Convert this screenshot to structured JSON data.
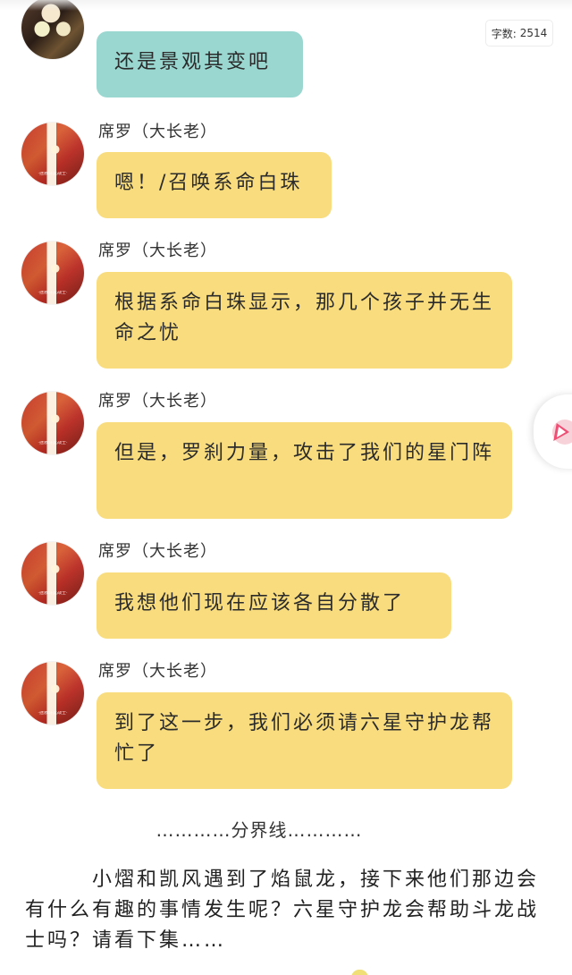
{
  "word_count": {
    "label": "字数:",
    "value": "2514"
  },
  "messages": [
    {
      "name": "",
      "text": "还是景观其变吧",
      "avatar_caption": "",
      "bubble_color": "#99d7d0"
    },
    {
      "name": "席罗（大长老）",
      "text": "嗯！/召唤系命白珠",
      "avatar_caption": "·拯救斗龙战士·",
      "bubble_color": "#f8dc7d"
    },
    {
      "name": "席罗（大长老）",
      "text": "根据系命白珠显示，那几个孩子并无生命之忧",
      "avatar_caption": "·拯救斗龙战士·",
      "bubble_color": "#f8dc7d"
    },
    {
      "name": "席罗（大长老）",
      "text": "但是，罗刹力量，攻击了我们的星门阵",
      "avatar_caption": "·拯救斗龙战士·",
      "bubble_color": "#f8dc7d"
    },
    {
      "name": "席罗（大长老）",
      "text": "我想他们现在应该各自分散了",
      "avatar_caption": "·拯救斗龙战士·",
      "bubble_color": "#f8dc7d"
    },
    {
      "name": "席罗（大长老）",
      "text": "到了这一步，我们必须请六星守护龙帮忙了",
      "avatar_caption": "·拯救斗龙战士·",
      "bubble_color": "#f8dc7d"
    }
  ],
  "divider": {
    "text": "…………分界线…………"
  },
  "narration": {
    "text": "小熠和凯风遇到了焰鼠龙，接下来他们那边会有什么有趣的事情发生呢？六星守护龙会帮助斗龙战士吗？请看下集……"
  },
  "icons": {
    "floating_play": "play-icon"
  }
}
